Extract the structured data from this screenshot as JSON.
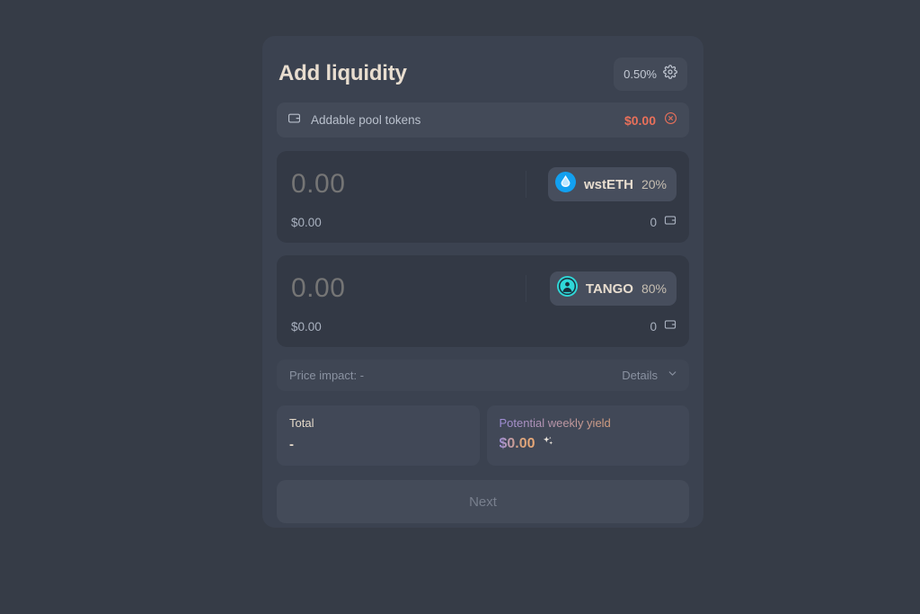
{
  "page": {
    "background_color": "#363c47"
  },
  "header": {
    "title": "Add liquidity",
    "slippage": "0.50%",
    "gear_icon": "gear-icon"
  },
  "addable_bar": {
    "wallet_icon": "wallet-icon",
    "label": "Addable pool tokens",
    "amount": "$0.00",
    "amount_color": "#e8705a",
    "close_icon": "close-circle-icon"
  },
  "tokens": [
    {
      "amount": "0.00",
      "amount_placeholder": "0.00",
      "usd_value": "$0.00",
      "symbol": "wstETH",
      "weight": "20%",
      "balance": "0",
      "wallet_icon": "wallet-icon",
      "icon_name": "wsteth-token-icon",
      "icon_color": "#12a0f0"
    },
    {
      "amount": "0.00",
      "amount_placeholder": "0.00",
      "usd_value": "$0.00",
      "symbol": "TANGO",
      "weight": "80%",
      "balance": "0",
      "wallet_icon": "wallet-icon",
      "icon_name": "tango-token-icon",
      "icon_color": "#2fd8d8"
    }
  ],
  "price_impact": {
    "label": "Price impact:",
    "value": "-",
    "details_label": "Details",
    "chevron_icon": "chevron-down-icon"
  },
  "summary": {
    "total_label": "Total",
    "total_value": "-",
    "yield_label": "Potential weekly yield",
    "yield_value": "$0.00",
    "sparkles_icon": "sparkles-icon"
  },
  "footer": {
    "next_label": "Next"
  }
}
